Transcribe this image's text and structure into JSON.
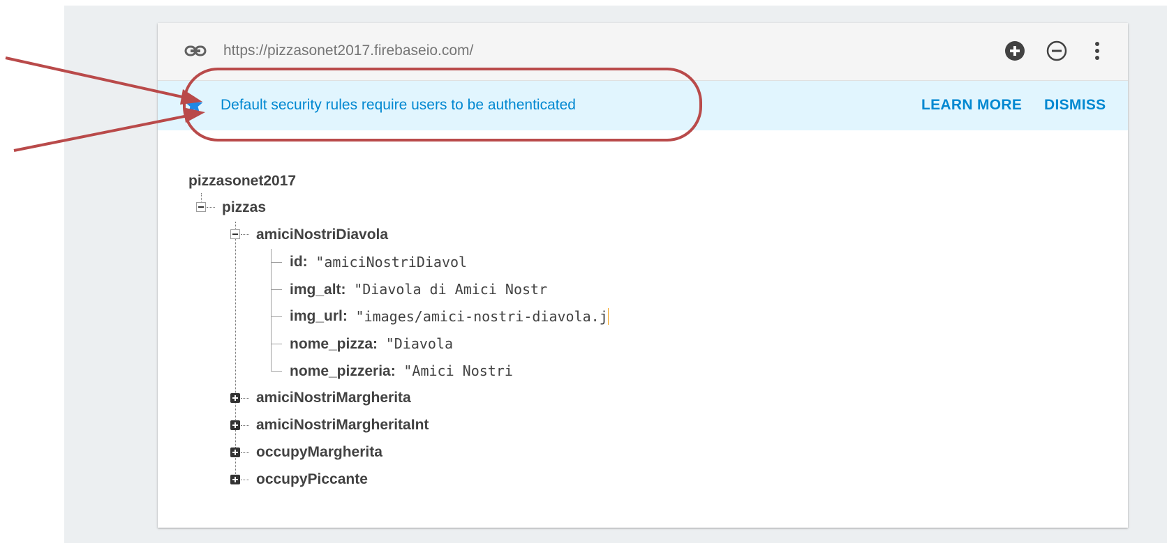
{
  "toolbar": {
    "url": "https://pizzasonet2017.firebaseio.com/",
    "icons": {
      "link": "link-icon",
      "add": "add-circle-icon",
      "remove": "remove-circle-icon",
      "more": "more-vert-icon"
    }
  },
  "banner": {
    "icon": "star-icon",
    "message": "Default security rules require users to be authenticated",
    "learn_more": "LEARN MORE",
    "dismiss": "DISMISS"
  },
  "tree": {
    "root": "pizzasonet2017",
    "pizzas_label": "pizzas",
    "expanded": {
      "key": "amiciNostriDiavola",
      "fields": [
        {
          "key": "id:",
          "value": "\"amiciNostriDiavol"
        },
        {
          "key": "img_alt:",
          "value": "\"Diavola di Amici Nostr"
        },
        {
          "key": "img_url:",
          "value": "\"images/amici-nostri-diavola.j"
        },
        {
          "key": "nome_pizza:",
          "value": "\"Diavola"
        },
        {
          "key": "nome_pizzeria:",
          "value": "\"Amici Nostri"
        }
      ]
    },
    "collapsed": [
      "amiciNostriMargherita",
      "amiciNostriMargheritaInt",
      "occupyMargherita",
      "occupyPiccante"
    ]
  },
  "colors": {
    "accent": "#0288d1",
    "banner_bg": "#e1f5fe",
    "annotation": "#b94a4a"
  }
}
